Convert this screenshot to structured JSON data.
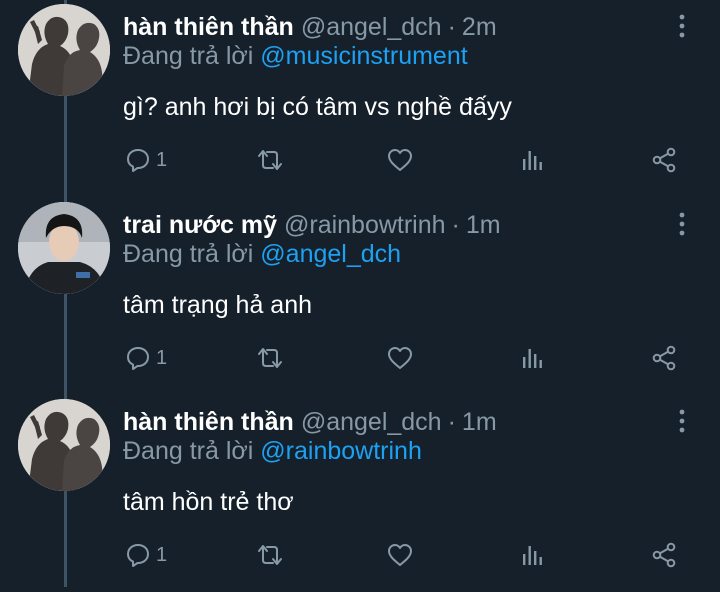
{
  "tweets": [
    {
      "name": "hàn thiên thần",
      "handle": "@angel_dch",
      "separator": "·",
      "time": "2m",
      "reply_prefix": "Đang trả lời",
      "reply_to": "@musicinstrument",
      "text": "gì? anh hơi bị có tâm vs nghề đấyy",
      "reply_count": "1",
      "avatar": "shadow-selfie-avatar"
    },
    {
      "name": "trai nước mỹ",
      "handle": "@rainbowtrinh",
      "separator": "·",
      "time": "1m",
      "reply_prefix": "Đang trả lời",
      "reply_to": "@angel_dch",
      "text": "tâm trạng hả anh",
      "reply_count": "1",
      "avatar": "person-photo-avatar"
    },
    {
      "name": "hàn thiên thần",
      "handle": "@angel_dch",
      "separator": "·",
      "time": "1m",
      "reply_prefix": "Đang trả lời",
      "reply_to": "@rainbowtrinh",
      "text": "tâm hồn trẻ thơ",
      "reply_count": "1",
      "avatar": "shadow-selfie-avatar"
    }
  ],
  "icons": {
    "reply": "comment-icon",
    "retweet": "retweet-icon",
    "like": "heart-icon",
    "analytics": "analytics-icon",
    "share": "share-icon",
    "more": "more-vertical-icon"
  },
  "colors": {
    "background": "#15202b",
    "text": "#ffffff",
    "secondary": "#8899a6",
    "link": "#1da1f2",
    "thread_line": "#3d5466"
  }
}
